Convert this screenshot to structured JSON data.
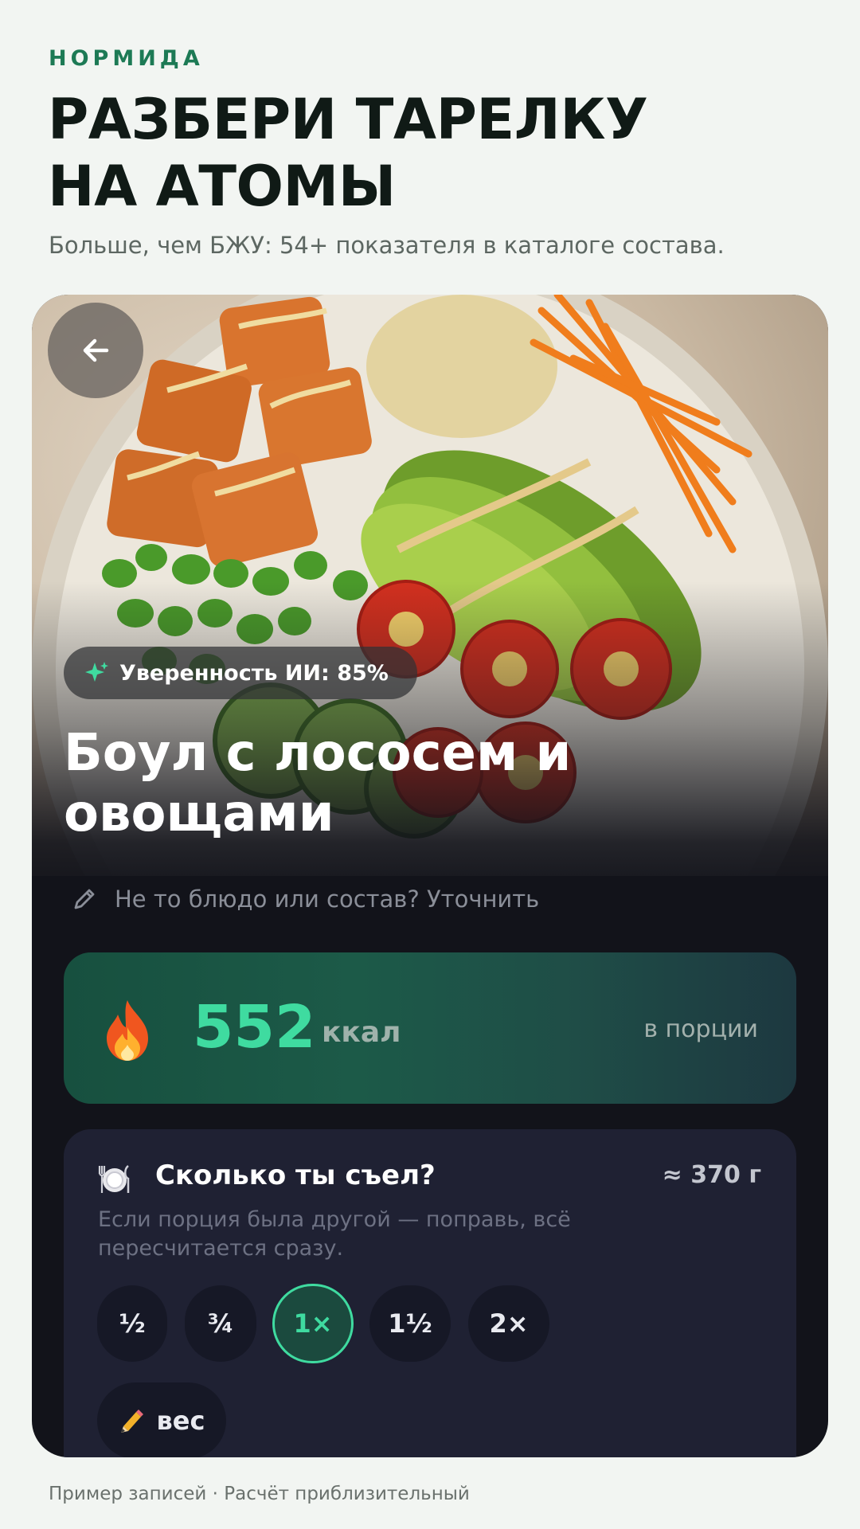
{
  "header": {
    "brand": "НОРМИДА",
    "headline_line1": "РАЗБЕРИ ТАРЕЛКУ",
    "headline_line2": "НА АТОМЫ",
    "subtitle": "Больше, чем БЖУ: 54+ показателя в каталоге состава."
  },
  "card": {
    "back_icon": "arrow-left-icon",
    "confidence": "Уверенность ИИ: 85%",
    "dish_title": "Боул с лососем и овощами",
    "refine_link": "Не то блюдо или состав? Уточнить",
    "calories": {
      "value": "552",
      "unit": "ккал",
      "per": "в порции",
      "icon": "fire-icon"
    },
    "portion": {
      "title": "Сколько ты съел?",
      "weight": "≈ 370 г",
      "hint": "Если порция была другой — поправь, всё пересчитается сразу.",
      "icon": "plate-icon",
      "options": [
        "½",
        "¾",
        "1×",
        "1½",
        "2×"
      ],
      "selected": "1×",
      "custom_label": "вес"
    }
  },
  "footer": "Пример записей · Расчёт приблизительный",
  "colors": {
    "accent": "#3fdba0",
    "brand": "#1d7a55",
    "card_bg": "#12131a",
    "panel_bg": "#1f2133"
  }
}
